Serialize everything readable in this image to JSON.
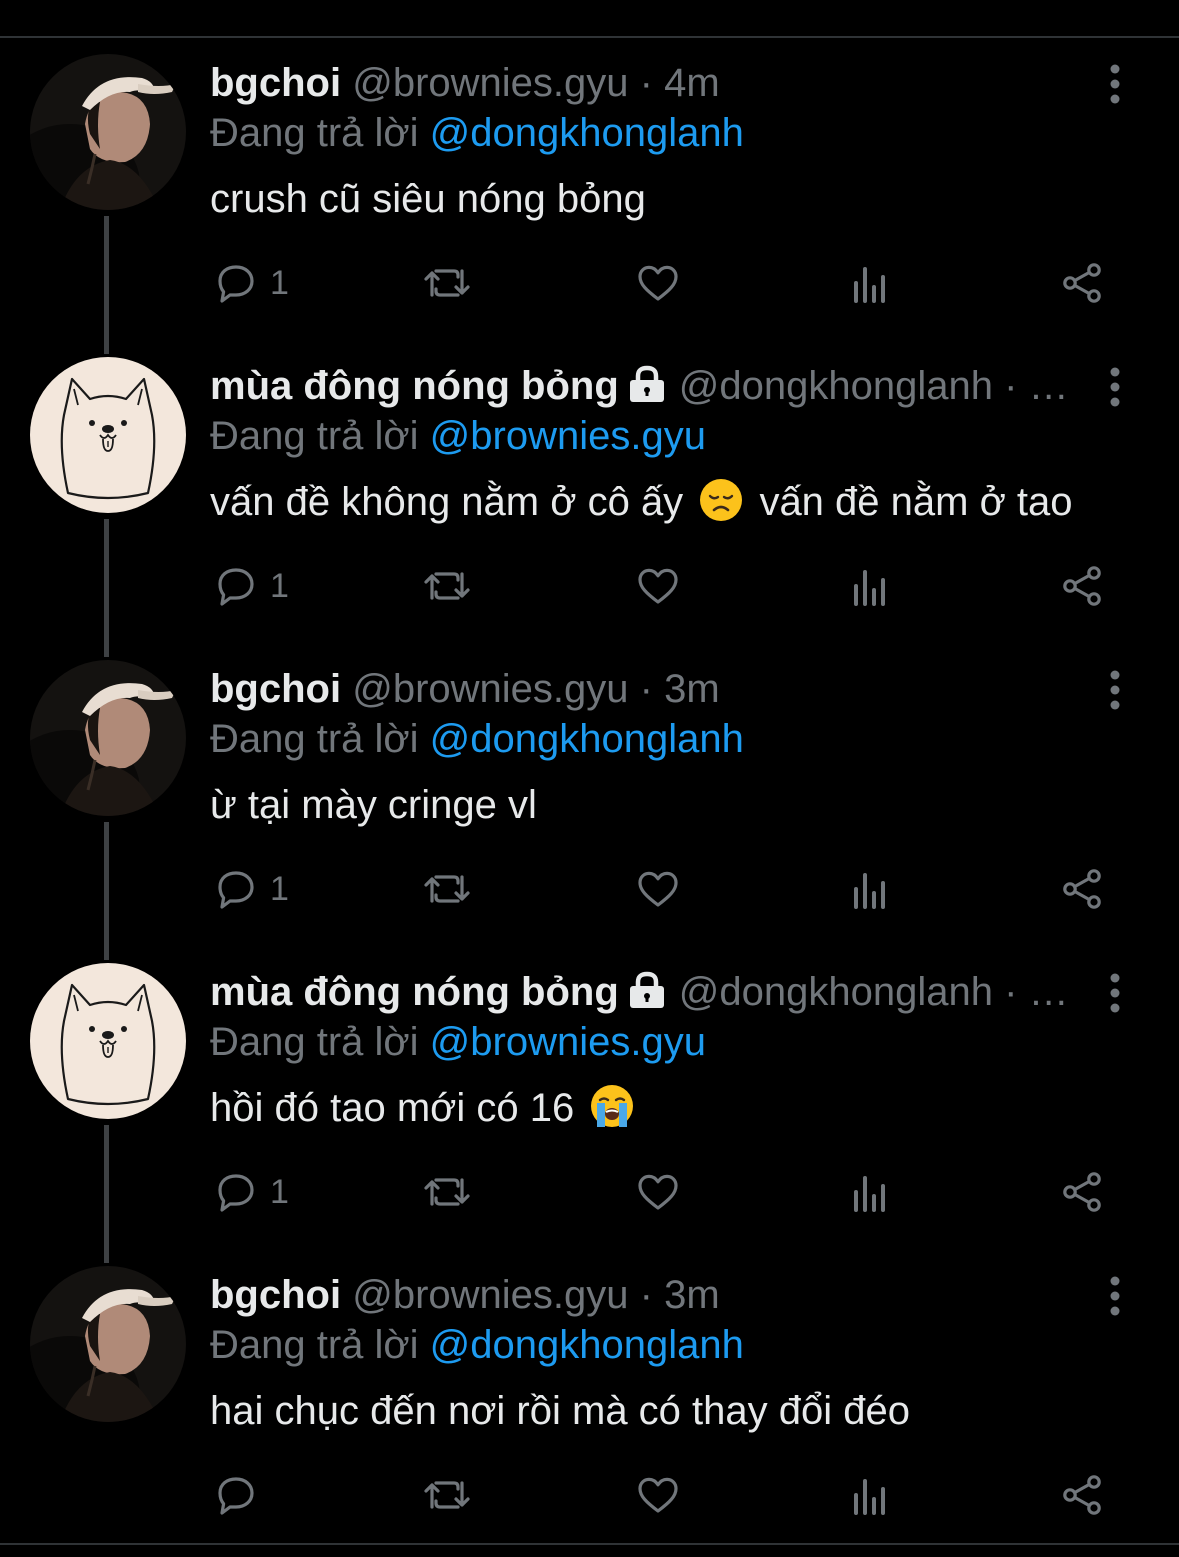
{
  "colors": {
    "background": "#000000",
    "text_primary": "#e7e9ea",
    "text_secondary": "#71767b",
    "link": "#1d9bf0",
    "thread_line": "#3e4144"
  },
  "tweets": [
    {
      "display_name": "bgchoi",
      "protected": false,
      "handle": "@brownies.gyu",
      "separator": "·",
      "time": "4m",
      "reply_prefix": "Đang trả lời",
      "reply_to": "@dongkhonglanh",
      "text_parts": [
        "crush cũ siêu nóng bỏng"
      ],
      "emojis": [],
      "reply_count": "1",
      "avatar": "person-photo-avatar"
    },
    {
      "display_name": "mùa đông nóng bỏng",
      "protected": true,
      "handle": "@dongkhonglanh",
      "separator": "·",
      "time": "…",
      "reply_prefix": "Đang trả lời",
      "reply_to": "@brownies.gyu",
      "text_parts": [
        "vấn đề không nằm ở cô ấy",
        "vấn đề nằm ở tao"
      ],
      "emojis": [
        "disappointed-face-emoji"
      ],
      "reply_count": "1",
      "avatar": "dog-drawing-avatar"
    },
    {
      "display_name": "bgchoi",
      "protected": false,
      "handle": "@brownies.gyu",
      "separator": "·",
      "time": "3m",
      "reply_prefix": "Đang trả lời",
      "reply_to": "@dongkhonglanh",
      "text_parts": [
        "ừ tại mày cringe vl"
      ],
      "emojis": [],
      "reply_count": "1",
      "avatar": "person-photo-avatar"
    },
    {
      "display_name": "mùa đông nóng bỏng",
      "protected": true,
      "handle": "@dongkhonglanh",
      "separator": "·",
      "time": "…",
      "reply_prefix": "Đang trả lời",
      "reply_to": "@brownies.gyu",
      "text_parts": [
        "hồi đó tao mới có 16"
      ],
      "emojis": [
        "crying-face-emoji"
      ],
      "reply_count": "1",
      "avatar": "dog-drawing-avatar"
    },
    {
      "display_name": "bgchoi",
      "protected": false,
      "handle": "@brownies.gyu",
      "separator": "·",
      "time": "3m",
      "reply_prefix": "Đang trả lời",
      "reply_to": "@dongkhonglanh",
      "text_parts": [
        "hai chục đến nơi rồi mà có thay đổi đéo"
      ],
      "emojis": [],
      "reply_count": "",
      "avatar": "person-photo-avatar"
    }
  ]
}
